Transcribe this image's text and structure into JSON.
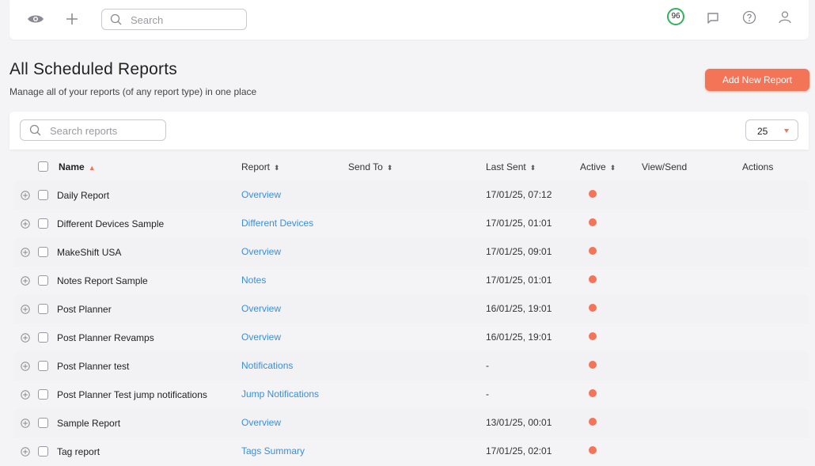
{
  "topbar": {
    "search_placeholder": "Search",
    "score": "96",
    "icons": [
      "eye-icon",
      "plus-icon",
      "search-icon",
      "chat-icon",
      "help-icon",
      "user-icon"
    ]
  },
  "page": {
    "title": "All Scheduled Reports",
    "subtitle": "Manage all of your reports (of any report type) in one place",
    "add_button": "Add New Report"
  },
  "toolbar": {
    "search_placeholder": "Search reports",
    "per_page": "25"
  },
  "table": {
    "headers": {
      "name": "Name",
      "report": "Report",
      "send_to": "Send To",
      "last_sent": "Last Sent",
      "active": "Active",
      "view_send": "View/Send",
      "actions": "Actions"
    },
    "rows": [
      {
        "name": "Daily Report",
        "report": "Overview",
        "last_sent": "17/01/25, 07:12"
      },
      {
        "name": "Different Devices Sample",
        "report": "Different Devices",
        "last_sent": "17/01/25, 01:01"
      },
      {
        "name": "MakeShift USA",
        "report": "Overview",
        "last_sent": "17/01/25, 09:01"
      },
      {
        "name": "Notes Report Sample",
        "report": "Notes",
        "last_sent": "17/01/25, 01:01"
      },
      {
        "name": "Post Planner",
        "report": "Overview",
        "last_sent": "16/01/25, 19:01"
      },
      {
        "name": "Post Planner Revamps",
        "report": "Overview",
        "last_sent": "16/01/25, 19:01"
      },
      {
        "name": "Post Planner test",
        "report": "Notifications",
        "last_sent": "-"
      },
      {
        "name": "Post Planner Test jump notifications",
        "report": "Jump Notifications",
        "last_sent": "-"
      },
      {
        "name": "Sample Report",
        "report": "Overview",
        "last_sent": "13/01/25, 00:01"
      },
      {
        "name": "Tag report",
        "report": "Tags Summary",
        "last_sent": "17/01/25, 02:01"
      }
    ]
  },
  "colors": {
    "accent": "#f47457",
    "link": "#3a8fd8",
    "score_ring": "#2fb35a"
  }
}
